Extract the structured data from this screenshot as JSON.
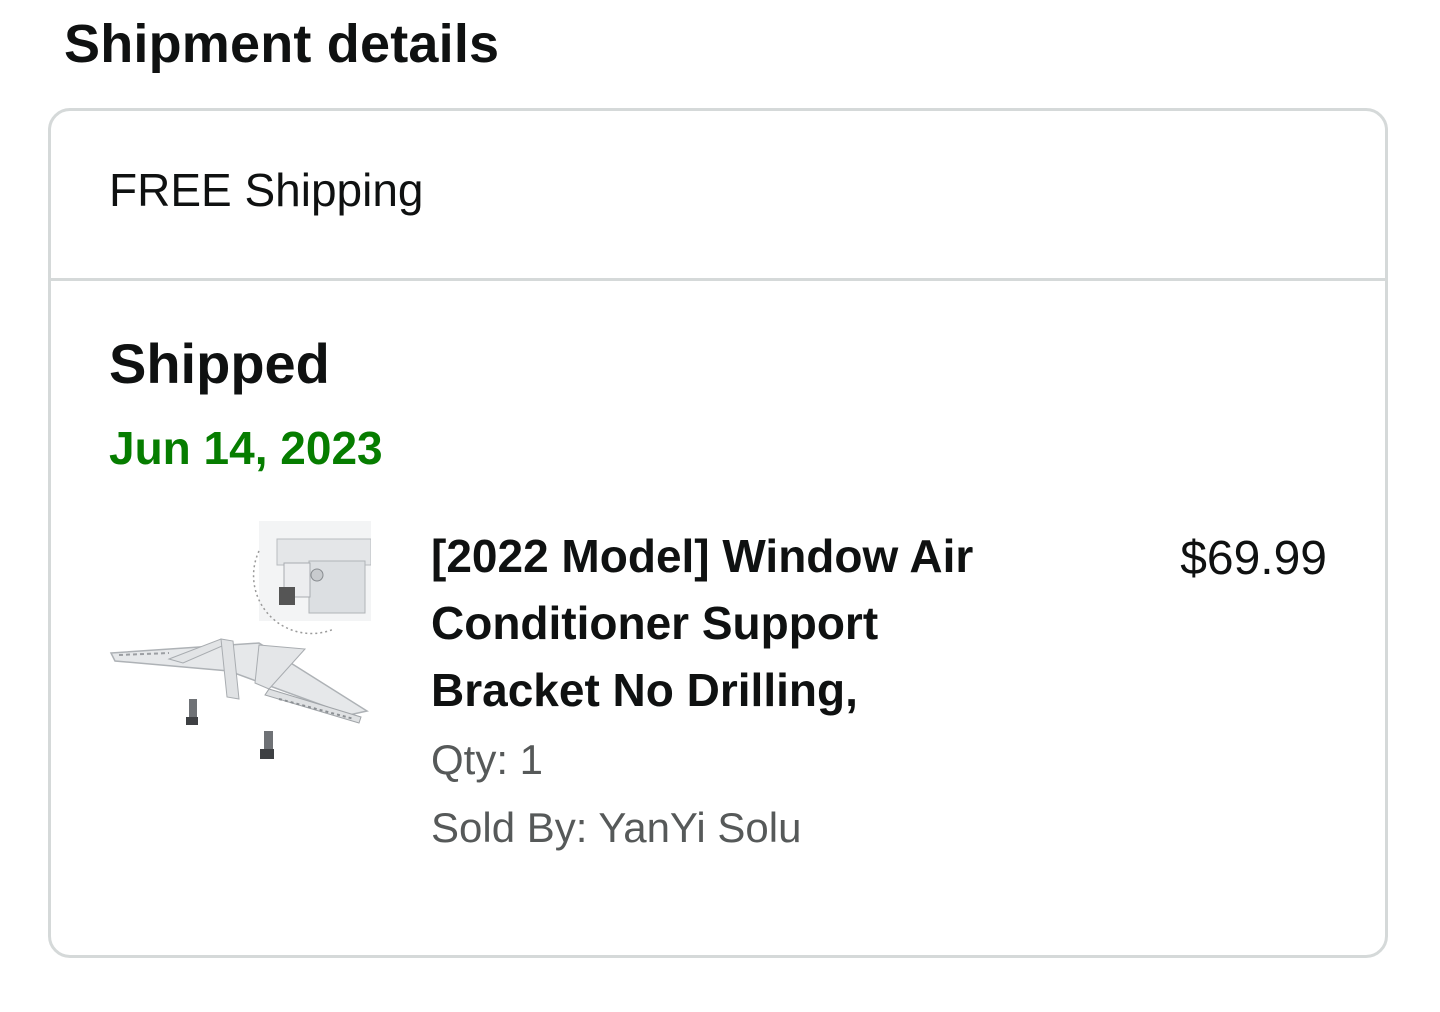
{
  "page": {
    "section_title": "Shipment details"
  },
  "shipment": {
    "shipping_speed": "FREE Shipping",
    "status": "Shipped",
    "status_date": "Jun 14, 2023",
    "colors": {
      "status_date": "#067d00",
      "border": "#d5d9d9",
      "secondary_text": "#565959"
    },
    "item": {
      "image_icon": "window-ac-support-bracket-image",
      "title": "[2022 Model] Window Air Conditioner Support Bracket No Drilling,",
      "price": "$69.99",
      "qty": "Qty: 1",
      "sold_by": "Sold By: YanYi Solu"
    }
  }
}
